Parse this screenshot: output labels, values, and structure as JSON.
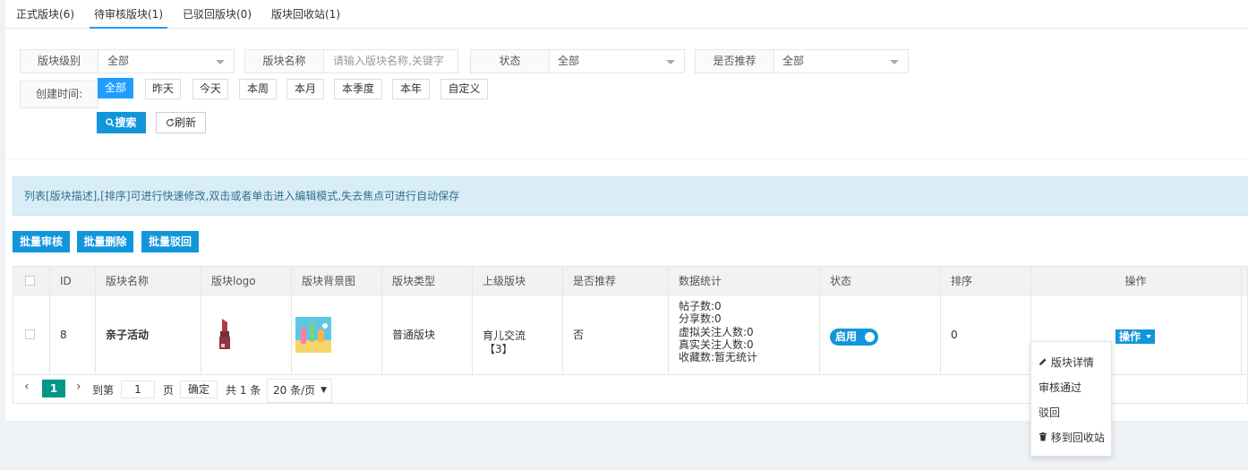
{
  "tabs": [
    "正式版块(6)",
    "待审核版块(1)",
    "已驳回版块(0)",
    "版块回收站(1)"
  ],
  "filters": {
    "level": {
      "label": "版块级别",
      "value": "全部"
    },
    "name": {
      "label": "版块名称",
      "placeholder": "请输入版块名称,关键字"
    },
    "status": {
      "label": "状态",
      "value": "全部"
    },
    "recommend": {
      "label": "是否推荐",
      "value": "全部"
    },
    "created": {
      "label": "创建时间:"
    },
    "time_options": [
      "全部",
      "昨天",
      "今天",
      "本周",
      "本月",
      "本季度",
      "本年",
      "自定义"
    ],
    "search_label": "搜索",
    "refresh_label": "刷新"
  },
  "notice": "列表[版块描述],[排序]可进行快速修改,双击或者单击进入编辑模式,失去焦点可进行自动保存",
  "batch": {
    "approve": "批量审核",
    "delete": "批量删除",
    "reject": "批量驳回"
  },
  "table": {
    "headers": [
      "ID",
      "版块名称",
      "版块logo",
      "版块背景图",
      "版块类型",
      "上级版块",
      "是否推荐",
      "数据统计",
      "状态",
      "排序",
      "操作"
    ],
    "rows": [
      {
        "id": "8",
        "name": "亲子活动",
        "type": "普通版块",
        "parent": "育儿交流",
        "parent_count": "【3】",
        "recommend": "否",
        "stats": [
          "帖子数:0",
          "分享数:0",
          "虚拟关注人数:0",
          "真实关注人数:0",
          "收藏数:暂无统计"
        ],
        "status": "启用",
        "sort": "0",
        "action": "操作"
      }
    ]
  },
  "pager": {
    "current": "1",
    "goto_label": "到第",
    "page_input": "1",
    "page_unit": "页",
    "confirm": "确定",
    "total": "共 1 条",
    "per_page": "20 条/页"
  },
  "action_menu": {
    "detail": "版块详情",
    "approve": "审核通过",
    "reject": "驳回",
    "recycle": "移到回收站"
  },
  "colors": {
    "accent": "#1e9fff",
    "button": "#1296db",
    "pager_active": "#009688",
    "notice_bg": "#d9edf7"
  }
}
